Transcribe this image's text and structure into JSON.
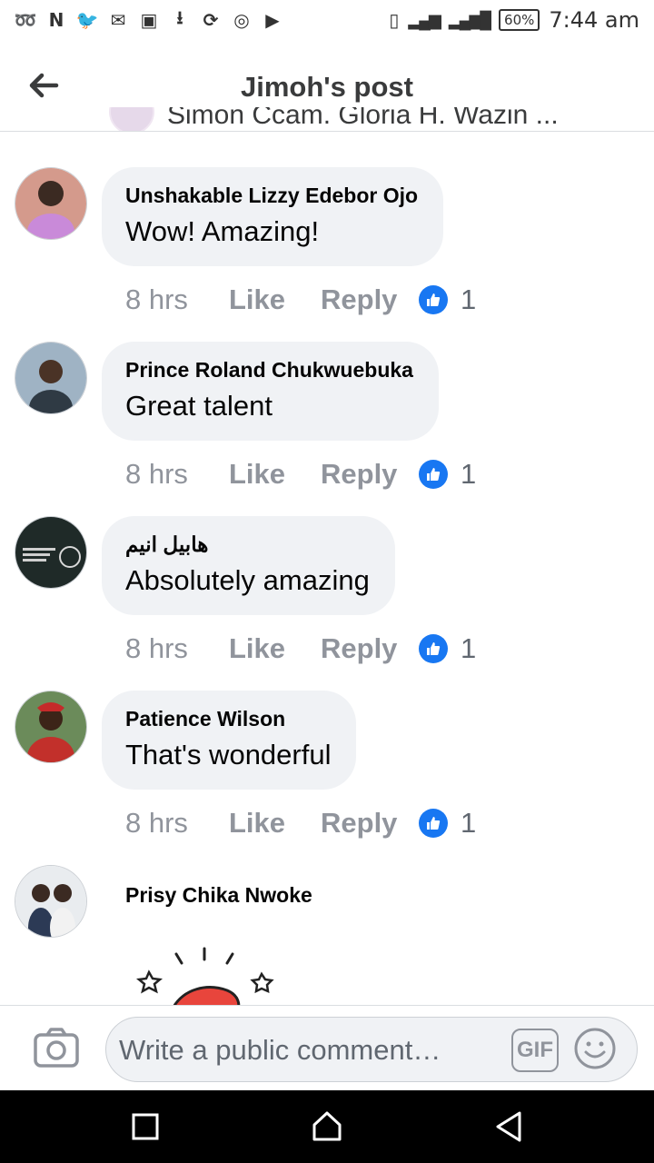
{
  "status_bar": {
    "left_icons": [
      "app-icon",
      "n-icon",
      "twitter-icon",
      "mail-icon",
      "image-icon",
      "download-icon",
      "sync-icon",
      "instagram-icon",
      "youtube-icon"
    ],
    "battery": "60%",
    "time": "7:44 am"
  },
  "header": {
    "title": "Jimoh's post"
  },
  "partial_comment": {
    "text": "Simon Ccam. Gloria H. Wazin ..."
  },
  "comments": [
    {
      "name": "Unshakable Lizzy Edebor Ojo",
      "text": "Wow! Amazing!",
      "time": "8 hrs",
      "like": "Like",
      "reply": "Reply",
      "reactions": "1",
      "avatar_color": "#c37a9a"
    },
    {
      "name": "Prince Roland Chukwuebuka",
      "text": "Great talent",
      "time": "8 hrs",
      "like": "Like",
      "reply": "Reply",
      "reactions": "1",
      "avatar_color": "#8aa0b5"
    },
    {
      "name": "هابيل انيم",
      "text": "Absolutely amazing",
      "time": "8 hrs",
      "like": "Like",
      "reply": "Reply",
      "reactions": "1",
      "avatar_color": "#1f2a28"
    },
    {
      "name": "Patience Wilson",
      "text": "That's wonderful",
      "time": "8 hrs",
      "like": "Like",
      "reply": "Reply",
      "reactions": "1",
      "avatar_color": "#b5332e"
    },
    {
      "name": "Prisy Chika Nwoke",
      "avatar_color": "#3a4f6e"
    }
  ],
  "composer": {
    "placeholder": "Write a public comment…",
    "gif_label": "GIF"
  },
  "colors": {
    "like_blue": "#1877f2",
    "bubble_bg": "#f0f2f5",
    "meta_gray": "#90949c"
  }
}
